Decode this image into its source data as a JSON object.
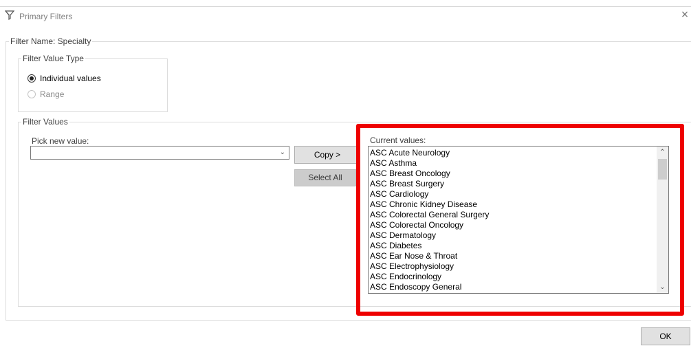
{
  "window": {
    "title": "Primary Filters",
    "close_glyph": "×",
    "icon": "funnel-icon"
  },
  "filter_name_group": {
    "legend": "Filter Name: Specialty"
  },
  "value_type_group": {
    "legend": "Filter Value Type",
    "options": [
      {
        "label": "Individual values",
        "checked": true,
        "enabled": true
      },
      {
        "label": "Range",
        "checked": false,
        "enabled": false
      }
    ]
  },
  "values_group": {
    "legend": "Filter Values",
    "pick_label": "Pick new value:",
    "pick_value": "",
    "copy_label": "Copy >",
    "select_all_label": "Select All",
    "current_label": "Current values:",
    "current_values": [
      "ASC Acute Neurology",
      "ASC Asthma",
      "ASC Breast Oncology",
      "ASC Breast Surgery",
      "ASC Cardiology",
      "ASC Chronic Kidney Disease",
      "ASC Colorectal General Surgery",
      "ASC Colorectal Oncology",
      "ASC Dermatology",
      "ASC Diabetes",
      "ASC Ear Nose & Throat",
      "ASC Electrophysiology",
      "ASC Endocrinology",
      "ASC Endoscopy General"
    ]
  },
  "footer": {
    "ok_label": "OK"
  },
  "colors": {
    "highlight": "#ee0000",
    "button_face": "#e1e1e1"
  }
}
